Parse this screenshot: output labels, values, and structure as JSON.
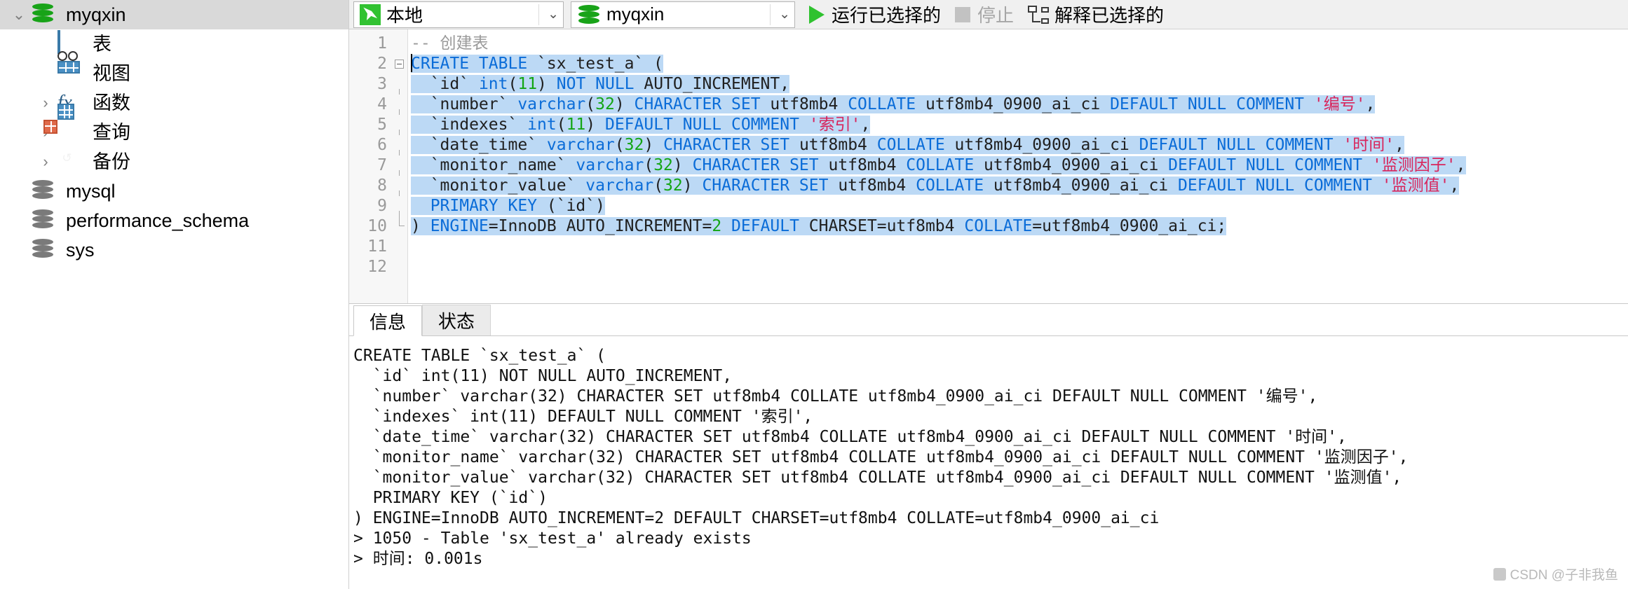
{
  "sidebar": {
    "items": [
      {
        "label": "myqxin",
        "icon": "database-icon",
        "twisty": "⌄",
        "level": 0,
        "selected": true,
        "kind": "db-green"
      },
      {
        "label": "表",
        "icon": "table-grid-icon",
        "twisty": "",
        "level": 1,
        "selected": false,
        "kind": "table"
      },
      {
        "label": "视图",
        "icon": "view-glasses-icon",
        "twisty": "",
        "level": 1,
        "selected": false,
        "kind": "view"
      },
      {
        "label": "函数",
        "icon": "function-fx-icon",
        "twisty": "›",
        "level": 1,
        "selected": false,
        "kind": "fx"
      },
      {
        "label": "查询",
        "icon": "query-icon",
        "twisty": "›",
        "level": 1,
        "selected": false,
        "kind": "query"
      },
      {
        "label": "备份",
        "icon": "backup-disk-icon",
        "twisty": "›",
        "level": 1,
        "selected": false,
        "kind": "backup"
      },
      {
        "label": "mysql",
        "icon": "database-icon",
        "twisty": "",
        "level": 0,
        "selected": false,
        "kind": "db-gray"
      },
      {
        "label": "performance_schema",
        "icon": "database-icon",
        "twisty": "",
        "level": 0,
        "selected": false,
        "kind": "db-gray"
      },
      {
        "label": "sys",
        "icon": "database-icon",
        "twisty": "",
        "level": 0,
        "selected": false,
        "kind": "db-gray"
      }
    ]
  },
  "toolbar": {
    "connection_select": {
      "value": "本地",
      "icon": "mysql-dolphin-icon",
      "caret": "⌄"
    },
    "database_select": {
      "value": "myqxin",
      "icon": "database-icon",
      "caret": "⌄"
    },
    "run_selected": {
      "label": "运行已选择的",
      "icon": "play-icon"
    },
    "stop": {
      "label": "停止",
      "icon": "stop-icon",
      "disabled": true
    },
    "explain_selected": {
      "label": "解释已选择的",
      "icon": "explain-icon"
    }
  },
  "editor": {
    "line_numbers": [
      "1",
      "2",
      "3",
      "4",
      "5",
      "6",
      "7",
      "8",
      "9",
      "10",
      "11",
      "12"
    ],
    "lines": [
      {
        "n": 1,
        "selected": false,
        "fold": "",
        "tokens": [
          {
            "t": "-- 创建表",
            "c": "cm"
          }
        ]
      },
      {
        "n": 2,
        "selected": true,
        "fold": "start",
        "tokens": [
          {
            "t": "CREATE TABLE ",
            "c": "k"
          },
          {
            "t": "`sx_test_a` (",
            "c": "p"
          }
        ]
      },
      {
        "n": 3,
        "selected": true,
        "fold": "bar",
        "tokens": [
          {
            "t": "  `id` ",
            "c": "p"
          },
          {
            "t": "int",
            "c": "k"
          },
          {
            "t": "(",
            "c": "p"
          },
          {
            "t": "11",
            "c": "n"
          },
          {
            "t": ") ",
            "c": "p"
          },
          {
            "t": "NOT NULL ",
            "c": "k"
          },
          {
            "t": "AUTO_INCREMENT,",
            "c": "p"
          }
        ]
      },
      {
        "n": 4,
        "selected": true,
        "fold": "bar",
        "tokens": [
          {
            "t": "  `number` ",
            "c": "p"
          },
          {
            "t": "varchar",
            "c": "k"
          },
          {
            "t": "(",
            "c": "p"
          },
          {
            "t": "32",
            "c": "n"
          },
          {
            "t": ") ",
            "c": "p"
          },
          {
            "t": "CHARACTER SET ",
            "c": "k"
          },
          {
            "t": "utf8mb4 ",
            "c": "p"
          },
          {
            "t": "COLLATE ",
            "c": "k"
          },
          {
            "t": "utf8mb4_0900_ai_ci ",
            "c": "p"
          },
          {
            "t": "DEFAULT NULL COMMENT ",
            "c": "k"
          },
          {
            "t": "'编号'",
            "c": "s"
          },
          {
            "t": ",",
            "c": "p"
          }
        ]
      },
      {
        "n": 5,
        "selected": true,
        "fold": "bar",
        "tokens": [
          {
            "t": "  `indexes` ",
            "c": "p"
          },
          {
            "t": "int",
            "c": "k"
          },
          {
            "t": "(",
            "c": "p"
          },
          {
            "t": "11",
            "c": "n"
          },
          {
            "t": ") ",
            "c": "p"
          },
          {
            "t": "DEFAULT NULL COMMENT ",
            "c": "k"
          },
          {
            "t": "'索引'",
            "c": "s"
          },
          {
            "t": ",",
            "c": "p"
          }
        ]
      },
      {
        "n": 6,
        "selected": true,
        "fold": "bar",
        "tokens": [
          {
            "t": "  `date_time` ",
            "c": "p"
          },
          {
            "t": "varchar",
            "c": "k"
          },
          {
            "t": "(",
            "c": "p"
          },
          {
            "t": "32",
            "c": "n"
          },
          {
            "t": ") ",
            "c": "p"
          },
          {
            "t": "CHARACTER SET ",
            "c": "k"
          },
          {
            "t": "utf8mb4 ",
            "c": "p"
          },
          {
            "t": "COLLATE ",
            "c": "k"
          },
          {
            "t": "utf8mb4_0900_ai_ci ",
            "c": "p"
          },
          {
            "t": "DEFAULT NULL COMMENT ",
            "c": "k"
          },
          {
            "t": "'时间'",
            "c": "s"
          },
          {
            "t": ",",
            "c": "p"
          }
        ]
      },
      {
        "n": 7,
        "selected": true,
        "fold": "bar",
        "tokens": [
          {
            "t": "  `monitor_name` ",
            "c": "p"
          },
          {
            "t": "varchar",
            "c": "k"
          },
          {
            "t": "(",
            "c": "p"
          },
          {
            "t": "32",
            "c": "n"
          },
          {
            "t": ") ",
            "c": "p"
          },
          {
            "t": "CHARACTER SET ",
            "c": "k"
          },
          {
            "t": "utf8mb4 ",
            "c": "p"
          },
          {
            "t": "COLLATE ",
            "c": "k"
          },
          {
            "t": "utf8mb4_0900_ai_ci ",
            "c": "p"
          },
          {
            "t": "DEFAULT NULL COMMENT ",
            "c": "k"
          },
          {
            "t": "'监测因子'",
            "c": "s"
          },
          {
            "t": ",",
            "c": "p"
          }
        ]
      },
      {
        "n": 8,
        "selected": true,
        "fold": "bar",
        "tokens": [
          {
            "t": "  `monitor_value` ",
            "c": "p"
          },
          {
            "t": "varchar",
            "c": "k"
          },
          {
            "t": "(",
            "c": "p"
          },
          {
            "t": "32",
            "c": "n"
          },
          {
            "t": ") ",
            "c": "p"
          },
          {
            "t": "CHARACTER SET ",
            "c": "k"
          },
          {
            "t": "utf8mb4 ",
            "c": "p"
          },
          {
            "t": "COLLATE ",
            "c": "k"
          },
          {
            "t": "utf8mb4_0900_ai_ci ",
            "c": "p"
          },
          {
            "t": "DEFAULT NULL COMMENT ",
            "c": "k"
          },
          {
            "t": "'监测值'",
            "c": "s"
          },
          {
            "t": ",",
            "c": "p"
          }
        ]
      },
      {
        "n": 9,
        "selected": true,
        "fold": "bar",
        "tokens": [
          {
            "t": "  PRIMARY KEY ",
            "c": "k"
          },
          {
            "t": "(`id`)",
            "c": "p"
          }
        ]
      },
      {
        "n": 10,
        "selected": true,
        "fold": "end",
        "tokens": [
          {
            "t": ") ",
            "c": "p"
          },
          {
            "t": "ENGINE",
            "c": "k"
          },
          {
            "t": "=InnoDB ",
            "c": "p"
          },
          {
            "t": "AUTO_INCREMENT",
            "c": "p"
          },
          {
            "t": "=",
            "c": "p"
          },
          {
            "t": "2",
            "c": "n"
          },
          {
            "t": " DEFAULT ",
            "c": "k"
          },
          {
            "t": "CHARSET=utf8mb4 ",
            "c": "p"
          },
          {
            "t": "COLLATE",
            "c": "k"
          },
          {
            "t": "=utf8mb4_0900_ai_ci;",
            "c": "p"
          }
        ]
      },
      {
        "n": 11,
        "selected": false,
        "fold": "",
        "tokens": [
          {
            "t": "",
            "c": "p"
          }
        ]
      },
      {
        "n": 12,
        "selected": false,
        "fold": "",
        "tokens": [
          {
            "t": "",
            "c": "p"
          }
        ]
      }
    ]
  },
  "results": {
    "tabs": [
      {
        "label": "信息",
        "active": true
      },
      {
        "label": "状态",
        "active": false
      }
    ],
    "output_lines": [
      "CREATE TABLE `sx_test_a` (",
      "  `id` int(11) NOT NULL AUTO_INCREMENT,",
      "  `number` varchar(32) CHARACTER SET utf8mb4 COLLATE utf8mb4_0900_ai_ci DEFAULT NULL COMMENT '编号',",
      "  `indexes` int(11) DEFAULT NULL COMMENT '索引',",
      "  `date_time` varchar(32) CHARACTER SET utf8mb4 COLLATE utf8mb4_0900_ai_ci DEFAULT NULL COMMENT '时间',",
      "  `monitor_name` varchar(32) CHARACTER SET utf8mb4 COLLATE utf8mb4_0900_ai_ci DEFAULT NULL COMMENT '监测因子',",
      "  `monitor_value` varchar(32) CHARACTER SET utf8mb4 COLLATE utf8mb4_0900_ai_ci DEFAULT NULL COMMENT '监测值',",
      "  PRIMARY KEY (`id`)",
      ") ENGINE=InnoDB AUTO_INCREMENT=2 DEFAULT CHARSET=utf8mb4 COLLATE=utf8mb4_0900_ai_ci",
      "> 1050 - Table 'sx_test_a' already exists",
      "> 时间: 0.001s"
    ]
  },
  "watermark": {
    "text": "CSDN @子非我鱼"
  },
  "colors": {
    "keyword": "#0a6cd8",
    "number": "#13a513",
    "string": "#d8255c",
    "comment": "#9a9a9a",
    "selection": "#bcd9f5",
    "accent_green": "#2fc22f"
  }
}
